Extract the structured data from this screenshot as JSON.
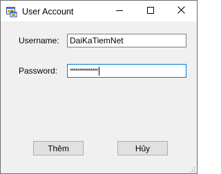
{
  "window": {
    "title": "User Account",
    "icon": "windows-form-icon",
    "controls": {
      "minimize_icon": "minimize-icon",
      "maximize_icon": "maximize-icon",
      "close_icon": "close-icon"
    }
  },
  "form": {
    "username": {
      "label": "Username:",
      "value": "DaiKaTiemNet"
    },
    "password": {
      "label": "Password:",
      "masked_value": "***************"
    }
  },
  "buttons": {
    "add_label": "Thêm",
    "cancel_label": "Hủy"
  },
  "colors": {
    "window_background": "#f0f0f0",
    "focus_border": "#0078d7",
    "button_background": "#e1e1e1"
  },
  "icons": {
    "resize_grip": "resize-grip-icon"
  }
}
